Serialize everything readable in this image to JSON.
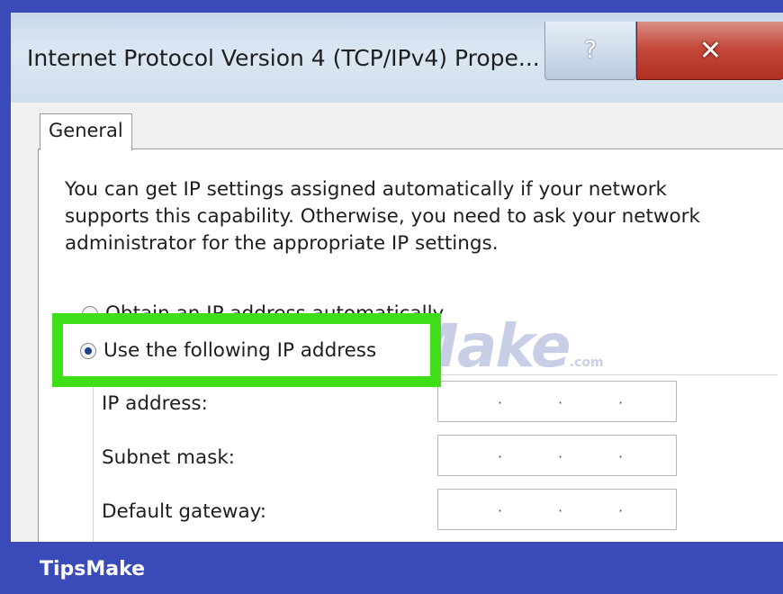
{
  "window": {
    "title": "Internet Protocol Version 4 (TCP/IPv4) Prope...",
    "help_glyph": "?",
    "close_glyph": "✕"
  },
  "tabs": [
    {
      "label": "General"
    }
  ],
  "description": "You can get IP settings assigned automatically if your network supports this capability. Otherwise, you need to ask your network administrator for the appropriate IP settings.",
  "options": {
    "auto": {
      "label": "Obtain an IP address automatically",
      "selected": false
    },
    "manual": {
      "label": "Use the following IP address",
      "selected": true
    }
  },
  "fields": [
    {
      "label": "IP address:",
      "value": ". . ."
    },
    {
      "label": "Subnet mask:",
      "value": ". . ."
    },
    {
      "label": "Default gateway:",
      "value": ". . ."
    }
  ],
  "watermark": {
    "text": "TipsMake",
    "suffix": ".com"
  },
  "footer": {
    "brand": "TipsMake"
  },
  "colors": {
    "frame": "#3a4ab8",
    "highlight": "#3ede18",
    "close": "#c44a3c"
  }
}
